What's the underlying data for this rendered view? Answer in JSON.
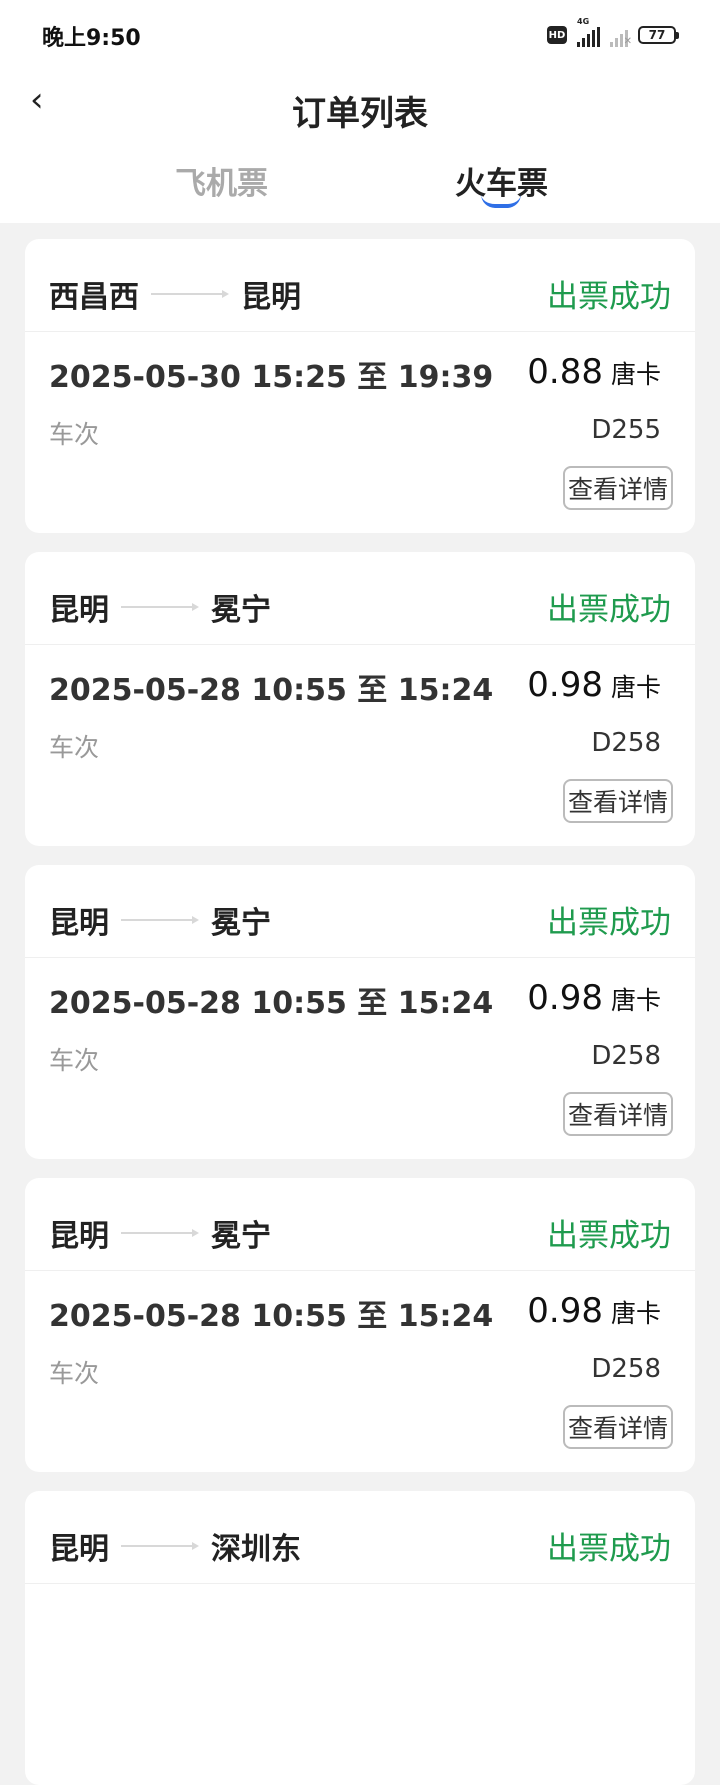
{
  "status_bar": {
    "time": "晚上9:50",
    "hd": "HD",
    "network": "4G",
    "battery": "77"
  },
  "header": {
    "title": "订单列表",
    "back_icon": "chevron-left-icon"
  },
  "tabs": [
    {
      "label": "飞机票",
      "active": false
    },
    {
      "label": "火车票",
      "active": true
    }
  ],
  "colors": {
    "success": "#1f9b4e",
    "accent": "#2f6fe6"
  },
  "orders": [
    {
      "from": "西昌西",
      "to": "昆明",
      "status": "出票成功",
      "datetime": "2025-05-30 15:25 至 19:39",
      "price": "0.88",
      "unit": "唐卡",
      "train_label": "车次",
      "train_no": "D255",
      "detail": "查看详情"
    },
    {
      "from": "昆明",
      "to": "冕宁",
      "status": "出票成功",
      "datetime": "2025-05-28 10:55 至 15:24",
      "price": "0.98",
      "unit": "唐卡",
      "train_label": "车次",
      "train_no": "D258",
      "detail": "查看详情"
    },
    {
      "from": "昆明",
      "to": "冕宁",
      "status": "出票成功",
      "datetime": "2025-05-28 10:55 至 15:24",
      "price": "0.98",
      "unit": "唐卡",
      "train_label": "车次",
      "train_no": "D258",
      "detail": "查看详情"
    },
    {
      "from": "昆明",
      "to": "冕宁",
      "status": "出票成功",
      "datetime": "2025-05-28 10:55 至 15:24",
      "price": "0.98",
      "unit": "唐卡",
      "train_label": "车次",
      "train_no": "D258",
      "detail": "查看详情"
    },
    {
      "from": "昆明",
      "to": "深圳东",
      "status": "出票成功",
      "datetime": "",
      "price": "",
      "unit": "",
      "train_label": "",
      "train_no": "",
      "detail": ""
    }
  ]
}
